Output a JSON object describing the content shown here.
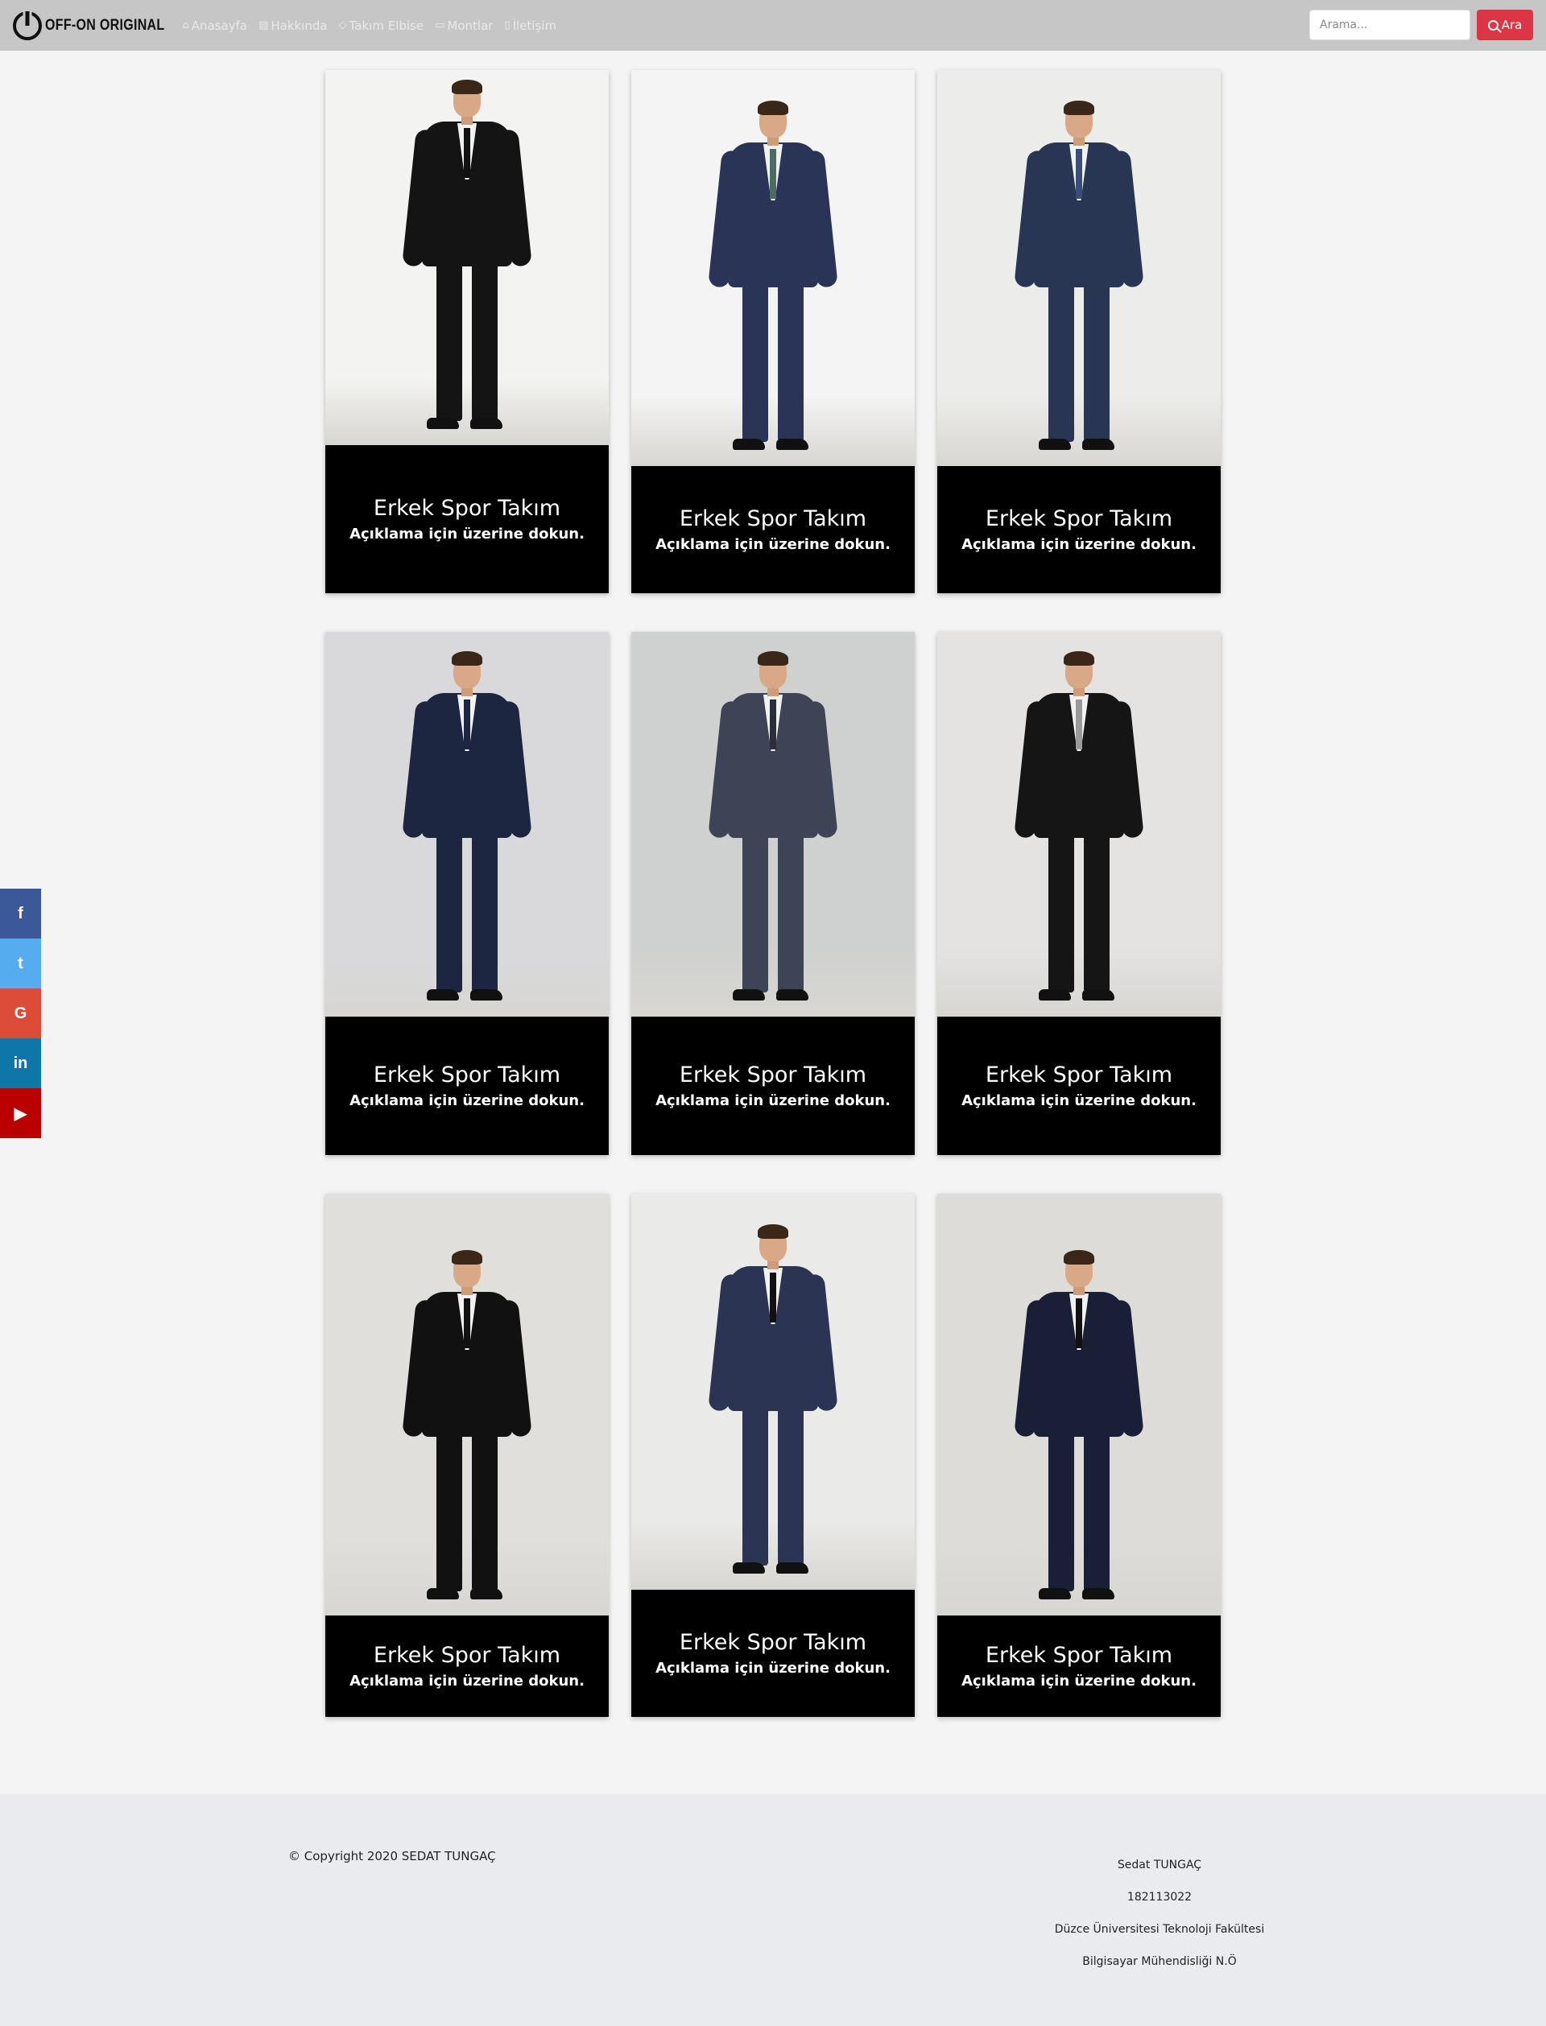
{
  "brand": {
    "name": "OFF-ON ORIGINAL",
    "logo_icon": "power-icon"
  },
  "nav": [
    {
      "label": "Anasayfa",
      "icon": "home-icon"
    },
    {
      "label": "Hakkında",
      "icon": "info-card-icon"
    },
    {
      "label": "Takım Elbise",
      "icon": "diamond-icon"
    },
    {
      "label": "Montlar",
      "icon": "jacket-icon"
    },
    {
      "label": "İletişim",
      "icon": "phone-icon"
    }
  ],
  "search": {
    "placeholder": "Arama...",
    "button_label": "Ara",
    "button_color": "#dc3545"
  },
  "social": [
    {
      "label": "f",
      "icon": "facebook-icon",
      "color": "#3b5998"
    },
    {
      "label": "t",
      "icon": "twitter-icon",
      "color": "#55acee"
    },
    {
      "label": "G",
      "icon": "google-icon",
      "color": "#dd4b39"
    },
    {
      "label": "in",
      "icon": "linkedin-icon",
      "color": "#0e76a8"
    },
    {
      "label": "▶",
      "icon": "youtube-icon",
      "color": "#bb0000"
    }
  ],
  "products": [
    {
      "title": "Erkek Spor Takım",
      "subtitle": "Açıklama için üzerine dokun.",
      "suit_color": "#141414",
      "tie_color": "#111111",
      "bg": "#f3f3f1"
    },
    {
      "title": "Erkek Spor Takım",
      "subtitle": "Açıklama için üzerine dokun.",
      "suit_color": "#2a3457",
      "tie_color": "#4a6c61",
      "bg": "#f4f4f4"
    },
    {
      "title": "Erkek Spor Takım",
      "subtitle": "Açıklama için üzerine dokun.",
      "suit_color": "#283654",
      "tie_color": "#3b4e7a",
      "bg": "#ececea"
    },
    {
      "title": "Erkek Spor Takım",
      "subtitle": "Açıklama için üzerine dokun.",
      "suit_color": "#1d2640",
      "tie_color": "#1d2640",
      "bg": "#d9d9dc"
    },
    {
      "title": "Erkek Spor Takım",
      "subtitle": "Açıklama için üzerine dokun.",
      "suit_color": "#3c4456",
      "tie_color": "#2a2f3a",
      "bg": "#cfd1d0"
    },
    {
      "title": "Erkek Spor Takım",
      "subtitle": "Açıklama için üzerine dokun.",
      "suit_color": "#151515",
      "tie_color": "#9a9a9a",
      "bg": "#e4e3e2"
    },
    {
      "title": "Erkek Spor Takım",
      "subtitle": "Açıklama için üzerine dokun.",
      "suit_color": "#111111",
      "tie_color": "#111111",
      "bg": "#e1dfdc"
    },
    {
      "title": "Erkek Spor Takım",
      "subtitle": "Açıklama için üzerine dokun.",
      "suit_color": "#2b3452",
      "tie_color": "#111111",
      "bg": "#eaeae8"
    },
    {
      "title": "Erkek Spor Takım",
      "subtitle": "Açıklama için üzerine dokun.",
      "suit_color": "#1a1f38",
      "tie_color": "#111111",
      "bg": "#dddcd8"
    }
  ],
  "footer": {
    "copyright": "© Copyright 2020 SEDAT TUNGAÇ",
    "info_lines": [
      "Sedat TUNGAÇ",
      "182113022",
      "Düzce Üniversitesi Teknoloji Fakültesi",
      "Bilgisayar Mühendisliği N.Ö"
    ]
  }
}
